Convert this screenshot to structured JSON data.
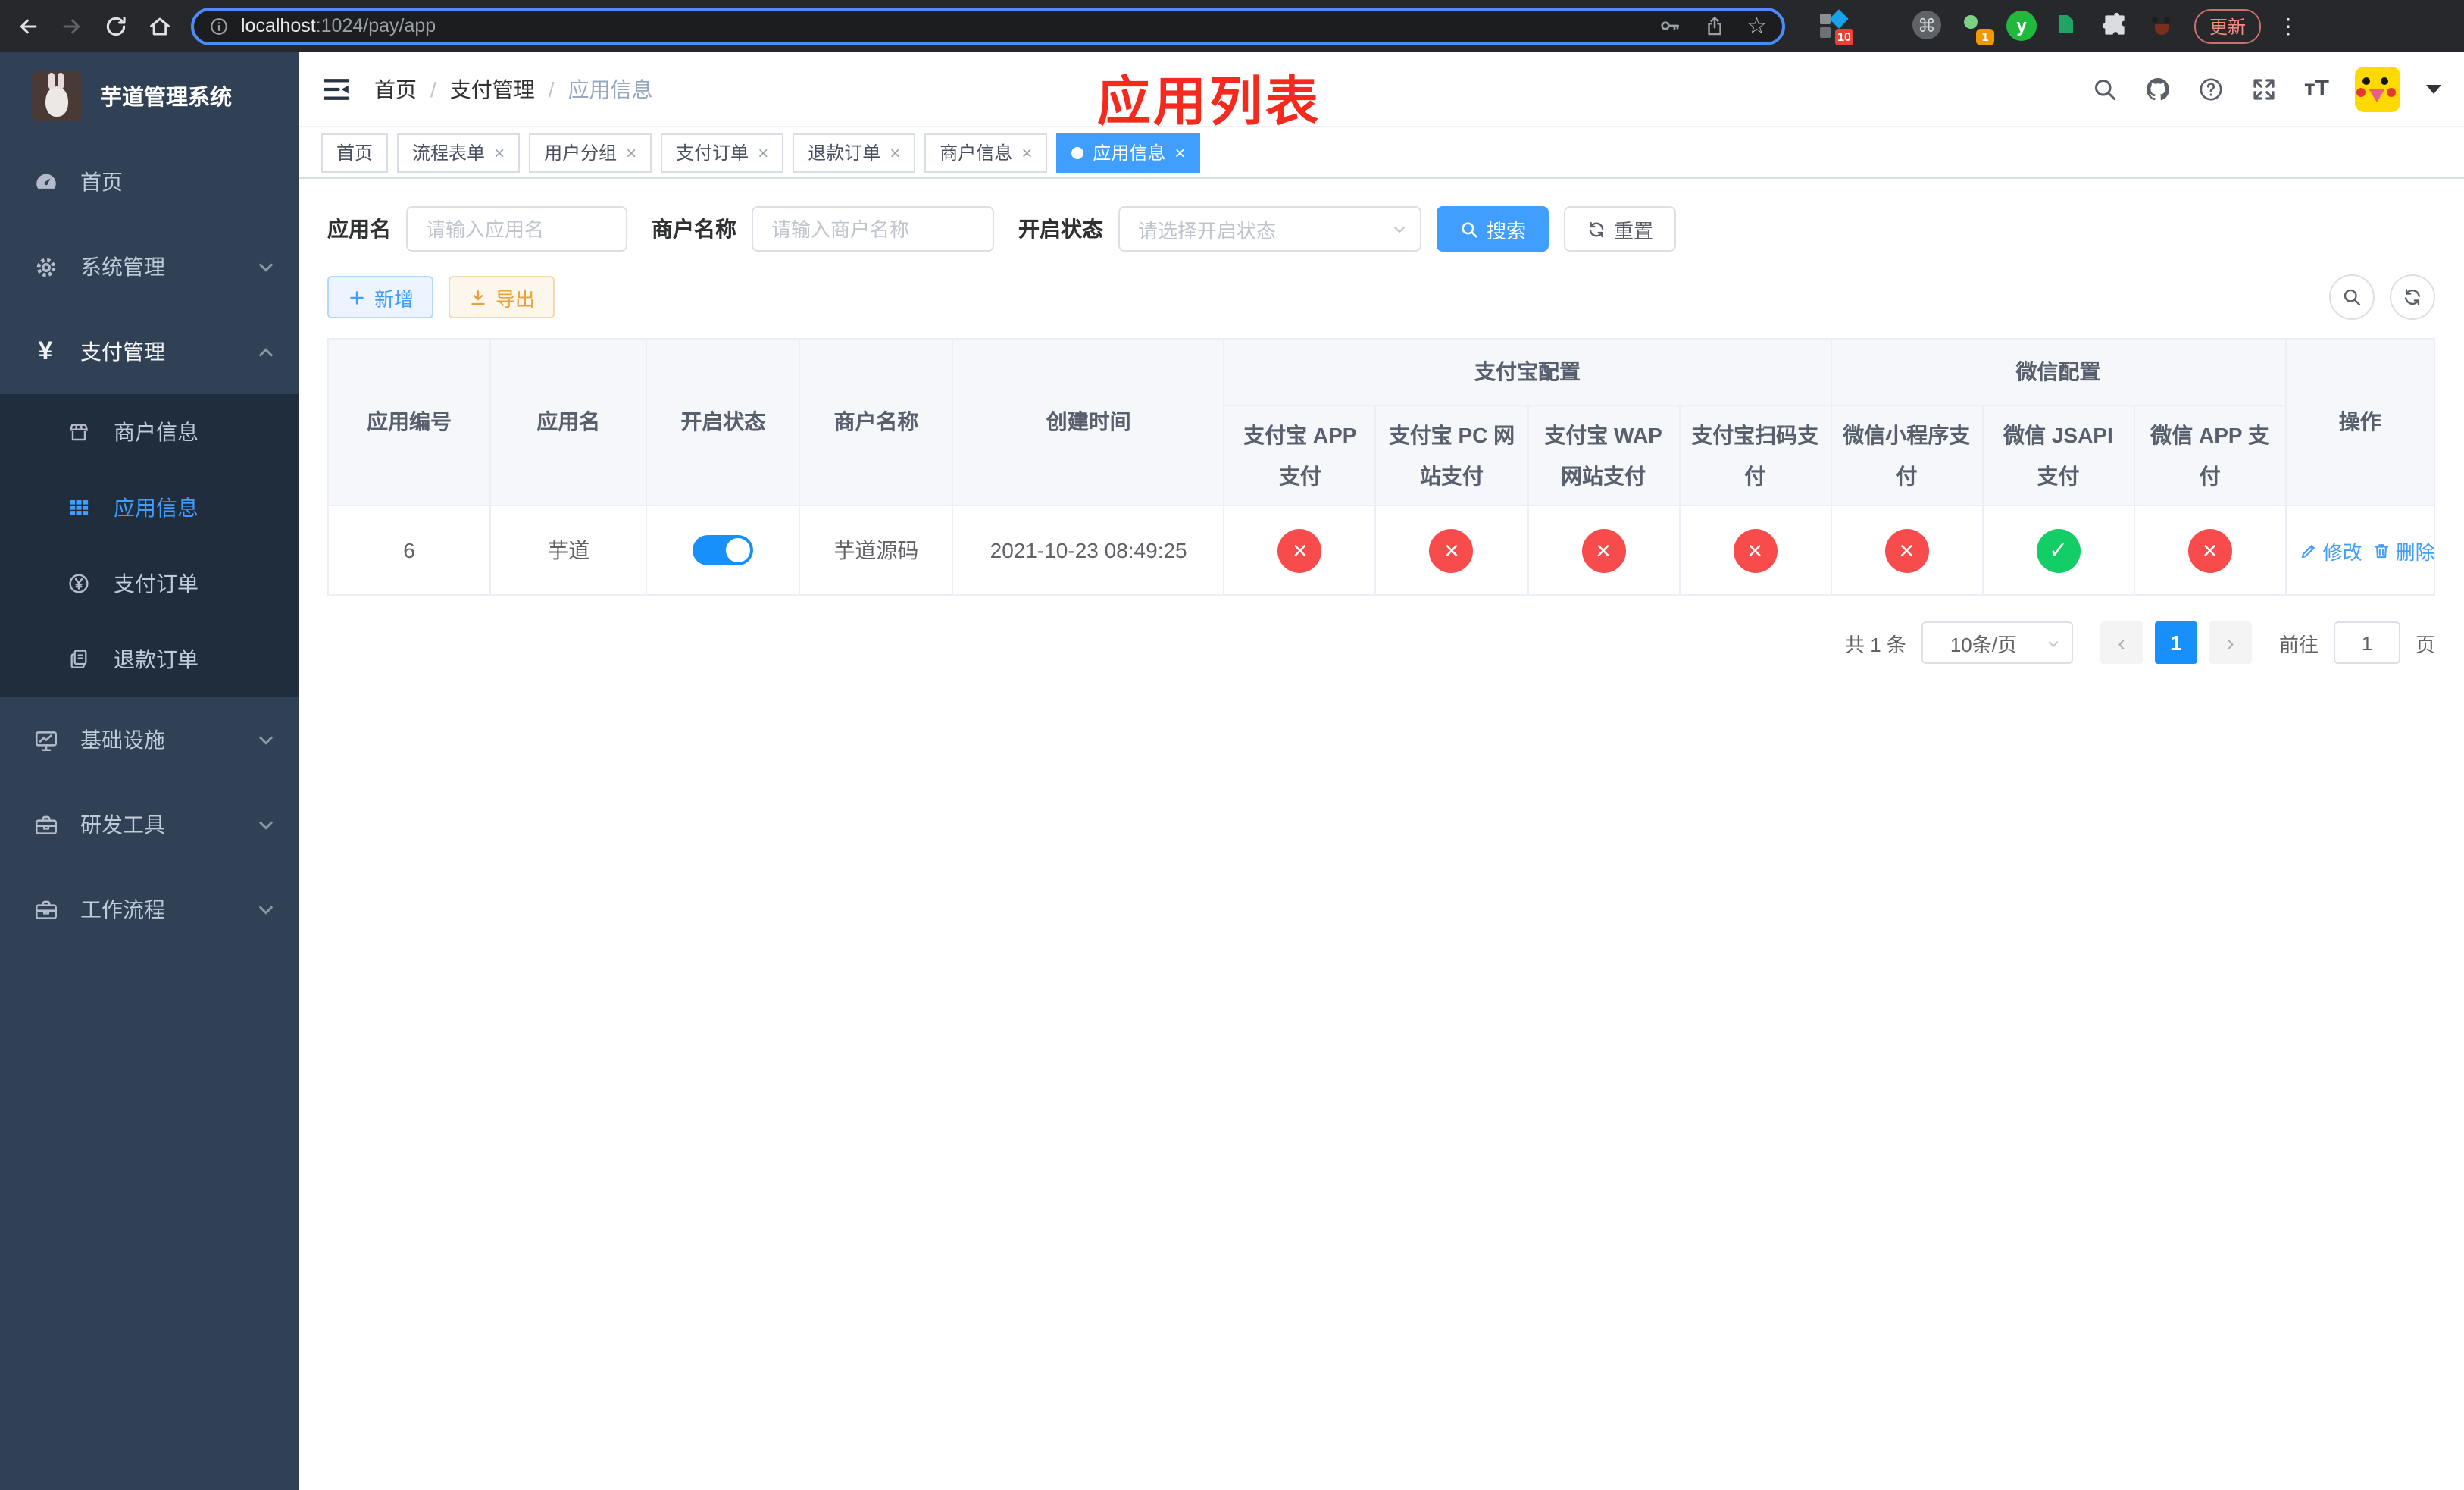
{
  "browser": {
    "url_host": "localhost",
    "url_path": ":1024/pay/app",
    "update_label": "更新",
    "ext_badge_count": "10",
    "profile_badge_count": "1",
    "yudao_ext_letter": "y",
    "command_glyph": "⌘"
  },
  "sidebar": {
    "title": "芋道管理系统",
    "items": [
      {
        "label": "首页",
        "icon": "dashboard-icon"
      },
      {
        "label": "系统管理",
        "icon": "gear-icon",
        "chevron": "down"
      },
      {
        "label": "支付管理",
        "icon": "yen-icon",
        "chevron": "up",
        "expanded": true,
        "children": [
          {
            "label": "商户信息",
            "icon": "shop-icon"
          },
          {
            "label": "应用信息",
            "icon": "grid-icon",
            "active": true
          },
          {
            "label": "支付订单",
            "icon": "yen-circle-icon"
          },
          {
            "label": "退款订单",
            "icon": "refund-doc-icon"
          }
        ]
      },
      {
        "label": "基础设施",
        "icon": "monitor-icon",
        "chevron": "down"
      },
      {
        "label": "研发工具",
        "icon": "toolbox-icon",
        "chevron": "down"
      },
      {
        "label": "工作流程",
        "icon": "toolbox-icon",
        "chevron": "down"
      }
    ]
  },
  "breadcrumb": {
    "items": [
      "首页",
      "支付管理",
      "应用信息"
    ],
    "separator": "/"
  },
  "annotation": {
    "text": "应用列表",
    "color": "#F42A1F"
  },
  "tabs": [
    {
      "label": "首页",
      "closable": false,
      "active": false
    },
    {
      "label": "流程表单",
      "closable": true,
      "active": false
    },
    {
      "label": "用户分组",
      "closable": true,
      "active": false
    },
    {
      "label": "支付订单",
      "closable": true,
      "active": false
    },
    {
      "label": "退款订单",
      "closable": true,
      "active": false
    },
    {
      "label": "商户信息",
      "closable": true,
      "active": false
    },
    {
      "label": "应用信息",
      "closable": true,
      "active": true
    }
  ],
  "filters": {
    "app_name_label": "应用名",
    "app_name_placeholder": "请输入应用名",
    "merchant_label": "商户名称",
    "merchant_placeholder": "请输入商户名称",
    "status_label": "开启状态",
    "status_placeholder": "请选择开启状态",
    "search_label": "搜索",
    "reset_label": "重置"
  },
  "toolbar": {
    "add_label": "新增",
    "export_label": "导出"
  },
  "table": {
    "col_app_id": "应用编号",
    "col_app_name": "应用名",
    "col_status": "开启状态",
    "col_merchant": "商户名称",
    "col_created": "创建时间",
    "group_alipay": "支付宝配置",
    "group_wechat": "微信配置",
    "col_alipay_app": "支付宝 APP 支付",
    "col_alipay_pc": "支付宝 PC 网站支付",
    "col_alipay_wap": "支付宝 WAP 网站支付",
    "col_alipay_qr": "支付宝扫码支付",
    "col_wx_mini": "微信小程序支付",
    "col_wx_jsapi": "微信 JSAPI 支付",
    "col_wx_app": "微信 APP 支付",
    "col_actions": "操作",
    "rows": [
      {
        "id": "6",
        "name": "芋道",
        "enabled": true,
        "merchant": "芋道源码",
        "created": "2021-10-23 08:49:25",
        "alipay_app": false,
        "alipay_pc": false,
        "alipay_wap": false,
        "alipay_qr": false,
        "wx_mini": false,
        "wx_jsapi": true,
        "wx_app": false,
        "edit_label": "修改",
        "delete_label": "删除"
      }
    ]
  },
  "pagination": {
    "total_text": "共 1 条",
    "page_size": "10条/页",
    "current_page": "1",
    "goto_label": "前往",
    "goto_value": "1",
    "page_unit": "页"
  },
  "icons": {
    "check": "✓",
    "cross": "×",
    "close_tab": "×",
    "star": "☆",
    "menu_dots": "⋮",
    "prev": "‹",
    "next": "›",
    "question": "?"
  },
  "colors": {
    "accent": "#409EFF",
    "toggle_on": "#1890FB",
    "success": "#13CE66",
    "danger": "#F84C4C",
    "warning": "#E6A23C",
    "annotation_red": "#F42A1F",
    "sidebar_bg": "#304156",
    "submenu_bg": "#1F2D3D",
    "tab_active": "#409EFF"
  }
}
